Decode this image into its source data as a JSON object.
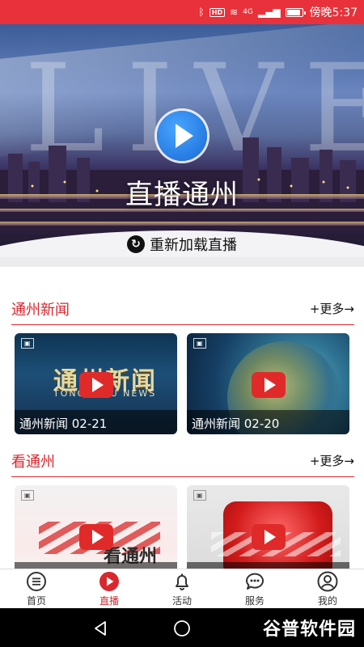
{
  "status_bar": {
    "network": "4G",
    "hd": "HD",
    "time": "傍晚5:37"
  },
  "hero": {
    "bg_text": "LIVE",
    "title": "直播通州",
    "reload_label": "重新加载直播"
  },
  "sections": [
    {
      "title": "通州新闻",
      "more": "+更多→",
      "cards": [
        {
          "caption": "通州新闻 02-21",
          "thumb_text": "通州新闻",
          "thumb_sub": "TONGZHOU NEWS"
        },
        {
          "caption": "通州新闻 02-20"
        }
      ]
    },
    {
      "title": "看通州",
      "more": "+更多→",
      "cards": [
        {
          "caption": "",
          "thumb_text": "看通州"
        },
        {
          "caption": ""
        }
      ]
    }
  ],
  "tabbar": {
    "items": [
      {
        "label": "首页",
        "icon": "menu-icon"
      },
      {
        "label": "直播",
        "icon": "play-icon",
        "active": true
      },
      {
        "label": "活动",
        "icon": "bell-icon"
      },
      {
        "label": "服务",
        "icon": "chat-icon"
      },
      {
        "label": "我的",
        "icon": "user-icon"
      }
    ]
  },
  "android_nav": {
    "watermark": "谷普软件园"
  },
  "colors": {
    "accent": "#e8313a",
    "section_red": "#d9272e"
  }
}
